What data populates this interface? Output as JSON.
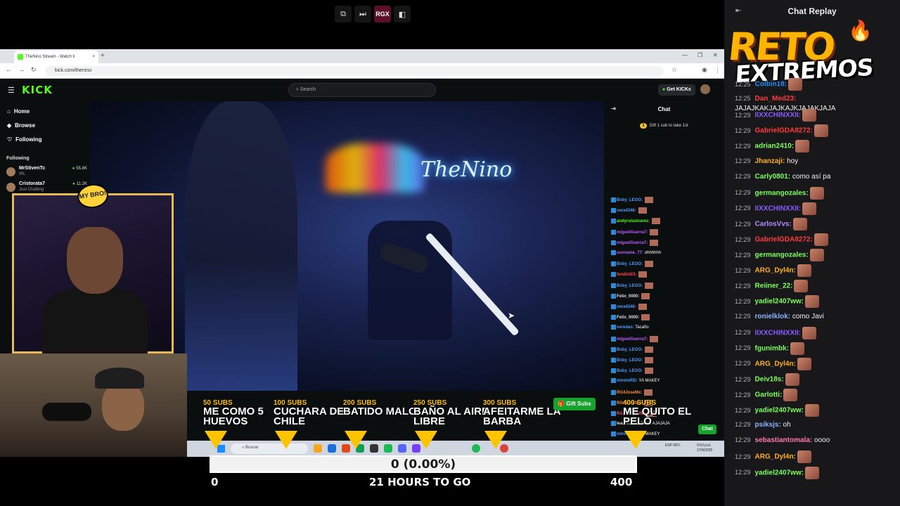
{
  "top_controls": {
    "rgx_label": "RGX"
  },
  "browser": {
    "tab_title": "TheNino Stream - Watch li",
    "url": "kick.com/thenino"
  },
  "kick": {
    "logo": "KICK",
    "search_placeholder": "Search",
    "get_kicks": "Get KICKs",
    "nav": [
      {
        "label": "Home",
        "icon": "home-icon"
      },
      {
        "label": "Browse",
        "icon": "compass-icon"
      },
      {
        "label": "Following",
        "icon": "heart-icon"
      }
    ],
    "following_heading": "Following",
    "following": [
      {
        "name": "MrStivenTc",
        "category": "IRL",
        "viewers": "55.8K"
      },
      {
        "name": "Cristorata7",
        "category": "Just Chatting",
        "viewers": "11.2K"
      }
    ],
    "chat_title": "Chat",
    "subgoal_text": "Gift 1 sub to take 1st",
    "subgoal_badge": "1",
    "chat_messages": [
      {
        "user": "Bxby_LEOO:",
        "color": "#4d9bff",
        "text": ""
      },
      {
        "user": "vera4346:",
        "color": "#4d9bff",
        "text": ""
      },
      {
        "user": "andyruizaivarez:",
        "color": "#53fc18",
        "text": ""
      },
      {
        "user": "miguelGuerra7:",
        "color": "#c05cff",
        "text": ""
      },
      {
        "user": "miguelGuerra7:",
        "color": "#c05cff",
        "text": ""
      },
      {
        "user": "usxname_77:",
        "color": "#c05cff",
        "text": "ohhhhhh"
      },
      {
        "user": "Bxby_LEOO:",
        "color": "#4d9bff",
        "text": ""
      },
      {
        "user": "fandinI23:",
        "color": "#ff4a4a",
        "text": ""
      },
      {
        "user": "Bxby_LEOO:",
        "color": "#4d9bff",
        "text": ""
      },
      {
        "user": "Felix_0000:",
        "color": "#dddddd",
        "text": ""
      },
      {
        "user": "vera4346:",
        "color": "#4d9bff",
        "text": ""
      },
      {
        "user": "Felix_0000:",
        "color": "#dddddd",
        "text": ""
      },
      {
        "user": "veredas:",
        "color": "#4d9bff",
        "text": "Tacaño"
      },
      {
        "user": "miguelGuerra7:",
        "color": "#c05cff",
        "text": ""
      },
      {
        "user": "Bxby_LEOO:",
        "color": "#4d9bff",
        "text": ""
      },
      {
        "user": "Bxby_LEOO:",
        "color": "#4d9bff",
        "text": ""
      },
      {
        "user": "Bxby_LEOO:",
        "color": "#4d9bff",
        "text": ""
      },
      {
        "user": "minimiRD:",
        "color": "#4d9bff",
        "text": "YA MAKEY"
      },
      {
        "user": "RG4JoseMx:",
        "color": "#ff8a3a",
        "text": ""
      },
      {
        "user": "RG4JoseMx:",
        "color": "#ff8a3a",
        "text": ""
      },
      {
        "user": "RANDY_MMM:",
        "color": "#ff4a4a",
        "text": ""
      },
      {
        "user": "leanderafk:",
        "color": "#dddddd",
        "text": "JAJAJAJAJAJA"
      },
      {
        "user": "minimiRD:",
        "color": "#4d9bff",
        "text": "YA MAKEY"
      }
    ],
    "gift_subs_label": "Gift Subs",
    "chat_button": "Chat"
  },
  "overlay": {
    "mybro_sticker": "MY BRO!",
    "goals": [
      {
        "subs": "50 SUBS",
        "title": "ME COMO 5 HUEVOS"
      },
      {
        "subs": "100 SUBS",
        "title": "CUCHARA DE CHILE"
      },
      {
        "subs": "200 SUBS",
        "title": "BATIDO MALO"
      },
      {
        "subs": "250 SUBS",
        "title": "BAÑO AL AIRE LIBRE"
      },
      {
        "subs": "300 SUBS",
        "title": "AFEITARME LA BARBA"
      },
      {
        "subs": "400 SUBS",
        "title": "ME QUITO EL PELO"
      }
    ],
    "progress_text": "0 (0.00%)",
    "progress_fraction": 0.0,
    "progress_start": "0",
    "progress_end": "400",
    "timer_text": "21 HOURS TO GO",
    "video_sign": "TheNino"
  },
  "taskbar": {
    "search_placeholder": "Buscar",
    "time": "9:53 p.m.",
    "date": "17/9/2025",
    "lang": "ESP INTL"
  },
  "replay": {
    "title": "Chat Replay",
    "logo_top": "RETO",
    "logo_bottom": "EXTREMOS",
    "messages": [
      {
        "time": "12:25",
        "user": "Colbin18:",
        "color": "#1e90ff",
        "text": "",
        "emote": true
      },
      {
        "time": "12:25",
        "user": "Dan_Med23:",
        "color": "#ff3b3b",
        "text": "JAJAJKAKJAJKAJKJAJAKJAJA",
        "emote": false
      },
      {
        "time": "12:29",
        "user": "IIXXCHINXXII:",
        "color": "#8a5cff",
        "text": "",
        "emote": true
      },
      {
        "time": "12:29",
        "user": "GabrielGDA8272:",
        "color": "#ff3b3b",
        "text": "",
        "emote": true
      },
      {
        "time": "12:29",
        "user": "adrian2410:",
        "color": "#7dff5a",
        "text": "",
        "emote": true
      },
      {
        "time": "12:29",
        "user": "Jhanzaji:",
        "color": "#ffb020",
        "text": "hoy",
        "emote": false
      },
      {
        "time": "12:29",
        "user": "Carly0801:",
        "color": "#7dff5a",
        "text": "como así pa",
        "emote": false
      },
      {
        "time": "12:29",
        "user": "germangozales:",
        "color": "#7dff5a",
        "text": "",
        "emote": true
      },
      {
        "time": "12:29",
        "user": "IIXXCHINXXII:",
        "color": "#8a5cff",
        "text": "",
        "emote": true
      },
      {
        "time": "12:29",
        "user": "CarlosVvs:",
        "color": "#b18cff",
        "text": "",
        "emote": true
      },
      {
        "time": "12:29",
        "user": "GabrielGDA8272:",
        "color": "#ff3b3b",
        "text": "",
        "emote": true
      },
      {
        "time": "12:29",
        "user": "germangozales:",
        "color": "#7dff5a",
        "text": "",
        "emote": true
      },
      {
        "time": "12:29",
        "user": "ARG_Dyl4n:",
        "color": "#ffb020",
        "text": "",
        "emote": true
      },
      {
        "time": "12:29",
        "user": "Reiiner_22:",
        "color": "#7dff5a",
        "text": "",
        "emote": true
      },
      {
        "time": "12:29",
        "user": "yadiel2407ww:",
        "color": "#7dff5a",
        "text": "",
        "emote": true
      },
      {
        "time": "12:29",
        "user": "ronielklok:",
        "color": "#8ab4ff",
        "text": "como Javi",
        "emote": false
      },
      {
        "time": "12:29",
        "user": "IIXXCHINXXII:",
        "color": "#8a5cff",
        "text": "",
        "emote": true
      },
      {
        "time": "12:29",
        "user": "fgunimbk:",
        "color": "#7dff5a",
        "text": "",
        "emote": true
      },
      {
        "time": "12:29",
        "user": "ARG_Dyl4n:",
        "color": "#ffb020",
        "text": "",
        "emote": true
      },
      {
        "time": "12:29",
        "user": "Deiv18s:",
        "color": "#7dff5a",
        "text": "",
        "emote": true
      },
      {
        "time": "12:29",
        "user": "Garlotti:",
        "color": "#7dff5a",
        "text": "",
        "emote": true
      },
      {
        "time": "12:29",
        "user": "yadiel2407ww:",
        "color": "#7dff5a",
        "text": "",
        "emote": true
      },
      {
        "time": "12:29",
        "user": "psiksjs:",
        "color": "#8ab4ff",
        "text": "oh",
        "emote": false
      },
      {
        "time": "12:29",
        "user": "sebastiantomala:",
        "color": "#ff7aa8",
        "text": "oooo",
        "emote": false
      },
      {
        "time": "12:29",
        "user": "ARG_Dyl4n:",
        "color": "#ffb020",
        "text": "",
        "emote": true
      },
      {
        "time": "12:29",
        "user": "yadiel2407ww:",
        "color": "#7dff5a",
        "text": "",
        "emote": true
      }
    ]
  },
  "colors": {
    "kick_green": "#53fc18",
    "goal_yellow": "#ffc400",
    "replay_bg": "#18181b"
  }
}
